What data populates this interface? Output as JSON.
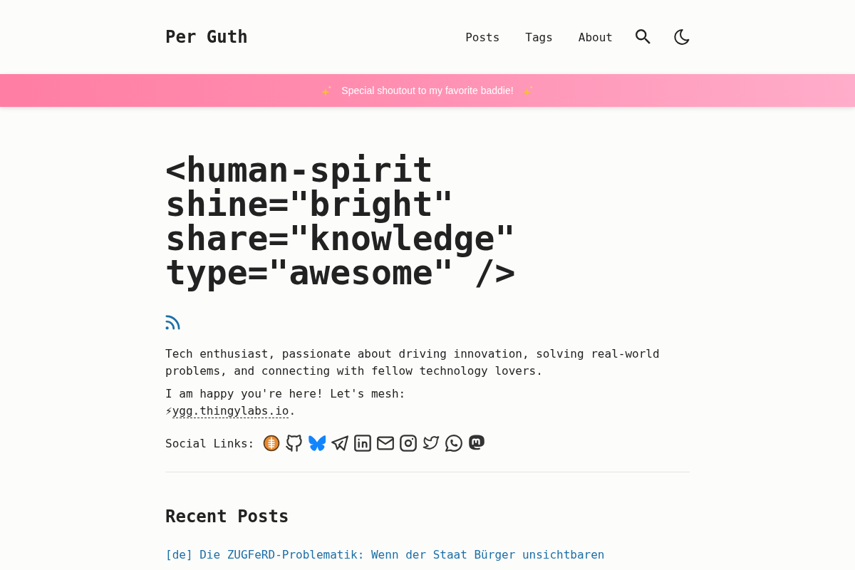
{
  "header": {
    "site_title": "Per Guth",
    "nav": [
      {
        "label": "Posts"
      },
      {
        "label": "Tags"
      },
      {
        "label": "About"
      }
    ]
  },
  "banner": {
    "text": "Special shoutout to my favorite baddie!"
  },
  "hero": {
    "title": "<human-spirit shine=\"bright\" share=\"knowledge\" type=\"awesome\" />",
    "bio": "Tech enthusiast, passionate about driving innovation, solving real-world problems, and connecting with fellow technology lovers.",
    "mesh": {
      "text": "I am happy you're here! Let's mesh:",
      "prefix": "⚡",
      "link": "ygg.thingylabs.io",
      "suffix": "."
    },
    "social_label": "Social Links:"
  },
  "recent_posts": {
    "heading": "Recent Posts",
    "posts": [
      {
        "title": "[de] Die ZUGFeRD-Problematik: Wenn der Staat Bürger unsichtbaren"
      }
    ]
  }
}
